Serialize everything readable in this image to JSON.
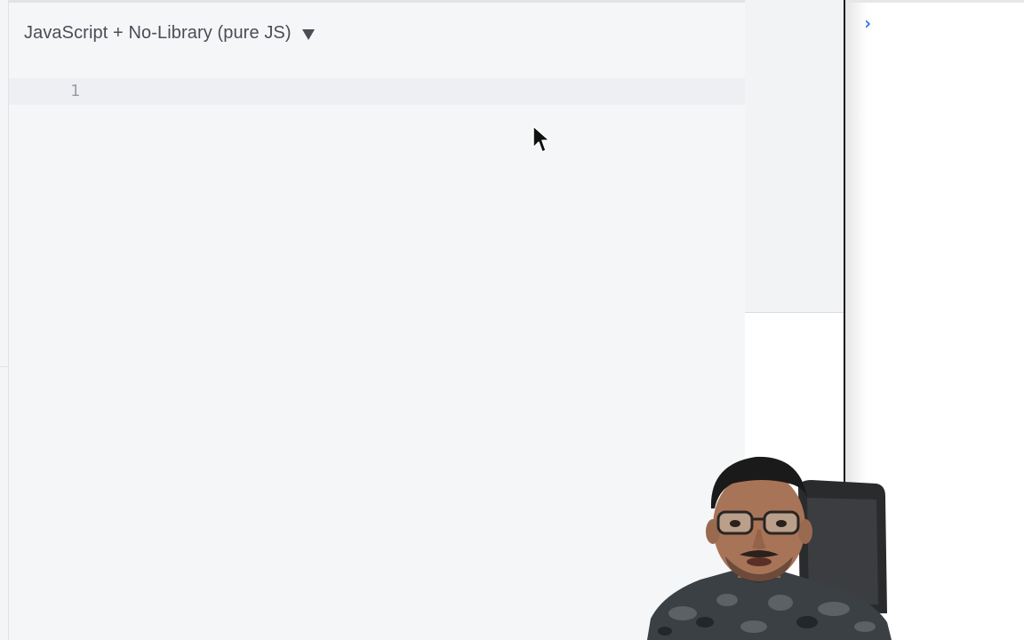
{
  "editor": {
    "language_label": "JavaScript + No-Library (pure JS)",
    "caret_icon": "caret-down-icon",
    "line_numbers": [
      "1"
    ]
  },
  "console": {
    "prompt_symbol": "›",
    "prompt_icon": "chevron-right-icon"
  },
  "colors": {
    "editor_background": "#f5f6f8",
    "console_prompt": "#2f6fe0",
    "divider": "#1c1c1c"
  }
}
